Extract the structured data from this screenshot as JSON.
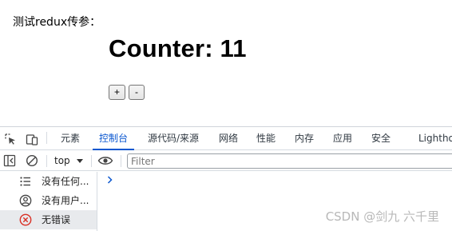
{
  "page": {
    "intro_text": "测试redux传参：",
    "counter_text": "Counter: 11",
    "buttons": {
      "increment": "+",
      "decrement": "-"
    }
  },
  "devtools": {
    "tabs": [
      {
        "label": "元素",
        "active": false
      },
      {
        "label": "控制台",
        "active": true
      },
      {
        "label": "源代码/来源",
        "active": false
      },
      {
        "label": "网络",
        "active": false
      },
      {
        "label": "性能",
        "active": false
      },
      {
        "label": "内存",
        "active": false
      },
      {
        "label": "应用",
        "active": false
      },
      {
        "label": "安全",
        "active": false
      },
      {
        "label": "Lightho",
        "active": false
      }
    ],
    "toolbar": {
      "context": "top",
      "filter_placeholder": "Filter"
    },
    "sidebar": {
      "items": [
        {
          "label": "没有任何...",
          "icon": "list-icon"
        },
        {
          "label": "没有用户...",
          "icon": "user-icon"
        },
        {
          "label": "无错误",
          "icon": "error-icon"
        }
      ]
    },
    "colors": {
      "accent": "#0b57d0",
      "error": "#d93025"
    }
  },
  "watermark": "CSDN @剑九 六千里"
}
